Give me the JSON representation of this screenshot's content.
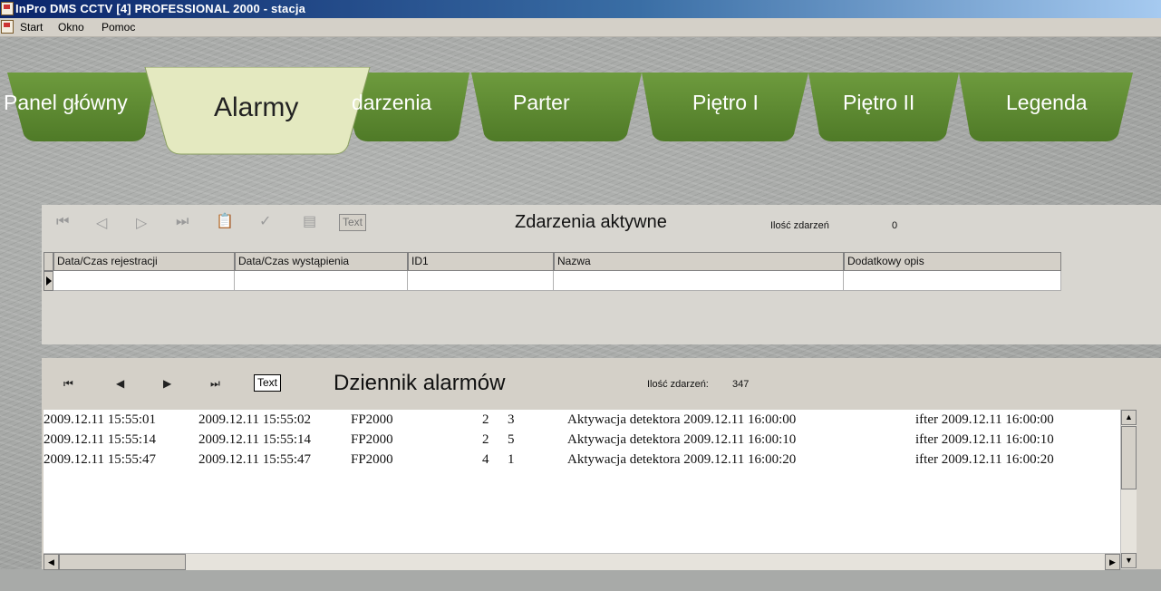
{
  "window": {
    "title": "InPro DMS  CCTV [4] PROFESSIONAL 2000 - stacja"
  },
  "menu": {
    "items": [
      "Start",
      "Okno",
      "Pomoc"
    ]
  },
  "tabs": [
    {
      "label": "Panel główny",
      "active": false
    },
    {
      "label": "Alarmy",
      "active": true
    },
    {
      "label": "darzenia",
      "active": false
    },
    {
      "label": "Parter",
      "active": false
    },
    {
      "label": "Piętro I",
      "active": false
    },
    {
      "label": "Piętro II",
      "active": false
    },
    {
      "label": "Legenda",
      "active": false
    }
  ],
  "colors": {
    "tab_green": "#5e8b32",
    "tab_active": "#e4e9c0",
    "titlebar": "#0a246a"
  },
  "events_panel": {
    "title": "Zdarzenia aktywne",
    "count_label": "Ilość zdarzeń",
    "count_value": "0",
    "text_button": "Text",
    "nav_icons": [
      "first-icon",
      "prev-icon",
      "next-icon",
      "last-icon",
      "clipboard-icon",
      "check-icon",
      "note-icon"
    ],
    "columns": [
      "Data/Czas rejestracji",
      "Data/Czas wystąpienia",
      "ID1",
      "Nazwa",
      "Dodatkowy opis"
    ]
  },
  "alarm_log": {
    "title": "Dziennik alarmów",
    "count_label": "Ilość zdarzeń:",
    "count_value": "347",
    "text_button": "Text",
    "rows": [
      {
        "reg": "2009.12.11 15:55:01",
        "occ": "2009.12.11 15:55:02",
        "device": "FP2000",
        "a": "2",
        "b": "3",
        "desc": "Aktywacja detektora 2009.12.11 16:00:00",
        "extra": "ifter 2009.12.11 16:00:00"
      },
      {
        "reg": "2009.12.11 15:55:14",
        "occ": "2009.12.11 15:55:14",
        "device": "FP2000",
        "a": "2",
        "b": "5",
        "desc": "Aktywacja detektora 2009.12.11 16:00:10",
        "extra": "ifter 2009.12.11 16:00:10"
      },
      {
        "reg": "2009.12.11 15:55:47",
        "occ": "2009.12.11 15:55:47",
        "device": "FP2000",
        "a": "4",
        "b": "1",
        "desc": "Aktywacja detektora 2009.12.11 16:00:20",
        "extra": "ifter 2009.12.11 16:00:20"
      }
    ]
  }
}
